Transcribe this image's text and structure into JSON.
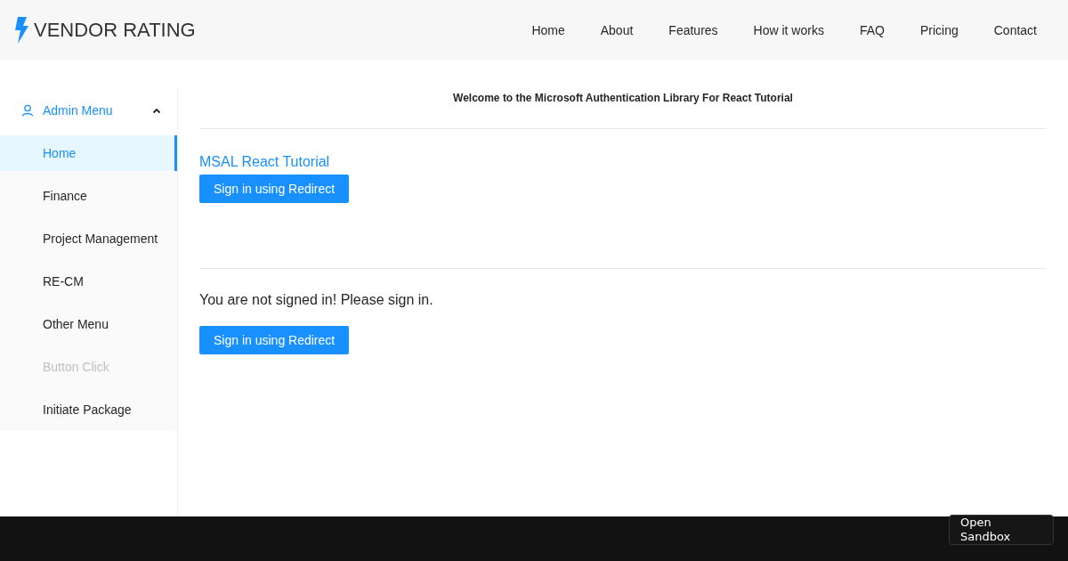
{
  "brand": {
    "title": "VENDOR RATING"
  },
  "nav": [
    "Home",
    "About",
    "Features",
    "How it works",
    "FAQ",
    "Pricing",
    "Contact"
  ],
  "sidebar": {
    "menu": {
      "label": "Admin Menu",
      "expanded": true
    },
    "items": [
      {
        "label": "Home",
        "selected": true,
        "disabled": false
      },
      {
        "label": "Finance",
        "selected": false,
        "disabled": false
      },
      {
        "label": "Project Management",
        "selected": false,
        "disabled": false
      },
      {
        "label": "RE-CM",
        "selected": false,
        "disabled": false
      },
      {
        "label": "Other Menu",
        "selected": false,
        "disabled": false
      },
      {
        "label": "Button Click",
        "selected": false,
        "disabled": true
      },
      {
        "label": "Initiate Package",
        "selected": false,
        "disabled": false
      }
    ]
  },
  "main": {
    "heading": "Welcome to the Microsoft Authentication Library For React Tutorial",
    "app_title": "MSAL React Tutorial",
    "top_button": "Sign in using Redirect",
    "message": "You are not signed in! Please sign in.",
    "bottom_button": "Sign in using Redirect"
  },
  "footer": {
    "sandbox_button": "Open Sandbox"
  }
}
